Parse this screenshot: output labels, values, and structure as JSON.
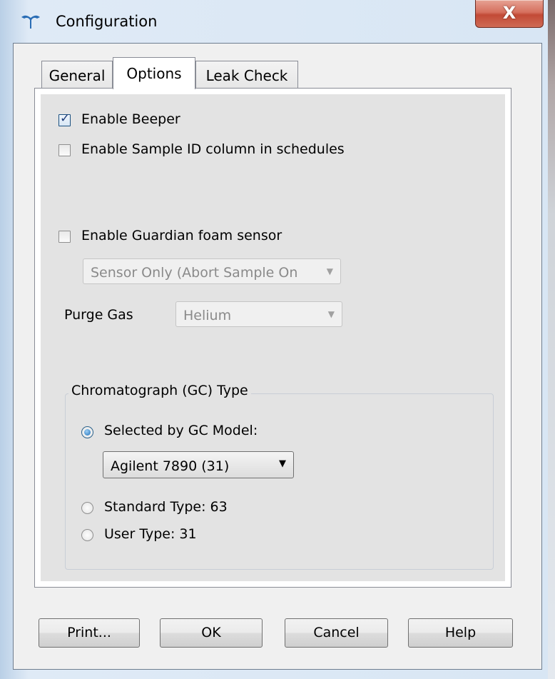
{
  "window": {
    "title": "Configuration",
    "close_glyph": "X",
    "icon": "teledyne-logo-icon"
  },
  "tabs": [
    {
      "label": "General",
      "active": false
    },
    {
      "label": "Options",
      "active": true
    },
    {
      "label": "Leak Check",
      "active": false
    }
  ],
  "options": {
    "enable_beeper": {
      "label": "Enable Beeper",
      "checked": true
    },
    "enable_sample_id": {
      "label": "Enable Sample ID column in schedules",
      "checked": false
    },
    "enable_guardian": {
      "label": "Enable Guardian foam sensor",
      "checked": false
    },
    "guardian_mode": {
      "value": "Sensor Only (Abort Sample On",
      "enabled": false
    },
    "purge_gas": {
      "label": "Purge Gas",
      "value": "Helium",
      "enabled": false
    }
  },
  "gc_type": {
    "title": "Chromatograph (GC) Type",
    "selected_by_model": {
      "label": "Selected by GC Model:",
      "selected": true
    },
    "model_dropdown": {
      "value": "Agilent 7890 (31)"
    },
    "standard_type": {
      "label": "Standard Type: 63",
      "selected": false
    },
    "user_type": {
      "label": "User Type: 31",
      "selected": false
    }
  },
  "buttons": {
    "print": "Print...",
    "ok": "OK",
    "cancel": "Cancel",
    "help": "Help"
  },
  "colors": {
    "close_button": "#c24a36",
    "checkbox_check": "#1f3d7a",
    "radio_dot": "#1d6fb8"
  }
}
